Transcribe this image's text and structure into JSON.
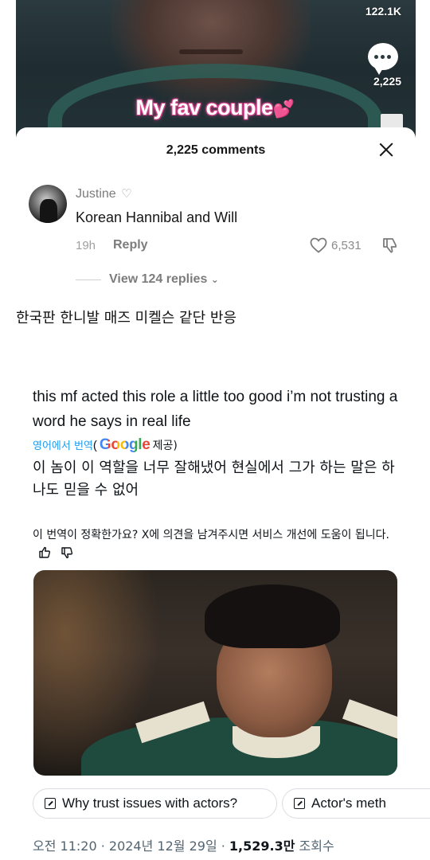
{
  "tiktok": {
    "like_count": "122.1K",
    "comment_count": "2,225",
    "video_caption": "My fav couple",
    "video_caption_emoji": "💕",
    "sheet_title": "2,225 comments",
    "comment": {
      "author": "Justine",
      "author_heart": "♡",
      "text": "Korean Hannibal and Will",
      "time": "19h",
      "reply_label": "Reply",
      "likes": "6,531",
      "view_replies": "View 124 replies"
    }
  },
  "post_caption": "한국판 한니발 매즈 미켈슨 같단 반응",
  "tweet": {
    "text": "this mf acted this role a little too good i’m not trusting a word he says in real life",
    "translate_link": "영어에서 번역",
    "open_paren": "(",
    "google_word": "Google",
    "translate_provider": "제공)",
    "translated_text": "이 놈이 이 역할을 너무 잘해냈어 현실에서 그가 하는 말은 하나도 믿을 수 없어",
    "feedback_text": "이 번역이 정확한가요? X에 의견을 남겨주시면 서비스 개선에 도움이 됩니다.",
    "chips": [
      "Why trust issues with actors?",
      "Actor's meth"
    ],
    "meta": {
      "time_date": "오전 11:20 · 2024년 12월 29일 · ",
      "views_count": "1,529.3만",
      "views_label": " 조회수"
    }
  },
  "colors": {
    "caption_pink": "#e04f96",
    "link_blue": "#1d9bf0",
    "meta_gray": "#536471"
  }
}
